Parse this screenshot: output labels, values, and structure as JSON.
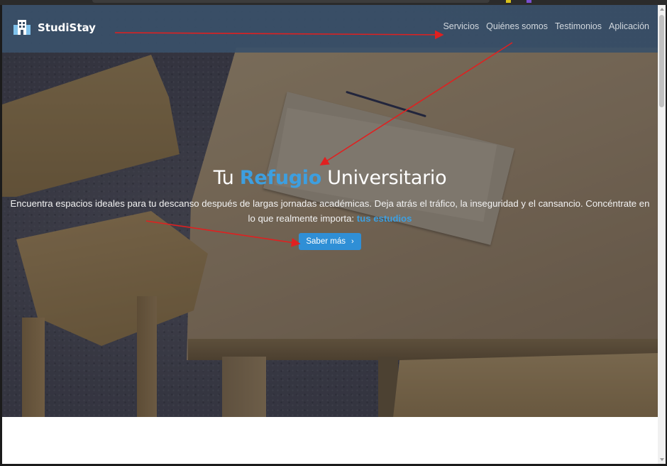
{
  "brand": {
    "name": "StudiStay",
    "logo_icon": "building-icon"
  },
  "nav": {
    "links": [
      "Servicios",
      "Quiénes somos",
      "Testimonios",
      "Aplicación"
    ]
  },
  "hero": {
    "title_before": "Tu",
    "title_accent": "Refugio",
    "title_after": "Universitario",
    "description": "Encuentra espacios ideales para tu descanso después de largas jornadas académicas. Deja atrás el tráfico, la inseguridad y el cansancio. Concéntrate en lo que realmente importa:",
    "description_highlight": "tus estudios",
    "cta_label": "Saber más",
    "cta_icon": "chevron-right-icon"
  },
  "colors": {
    "navbar": "#3a5069",
    "accent": "#3d9fe0",
    "button": "#2f8fd6",
    "annotation": "#e02020"
  }
}
